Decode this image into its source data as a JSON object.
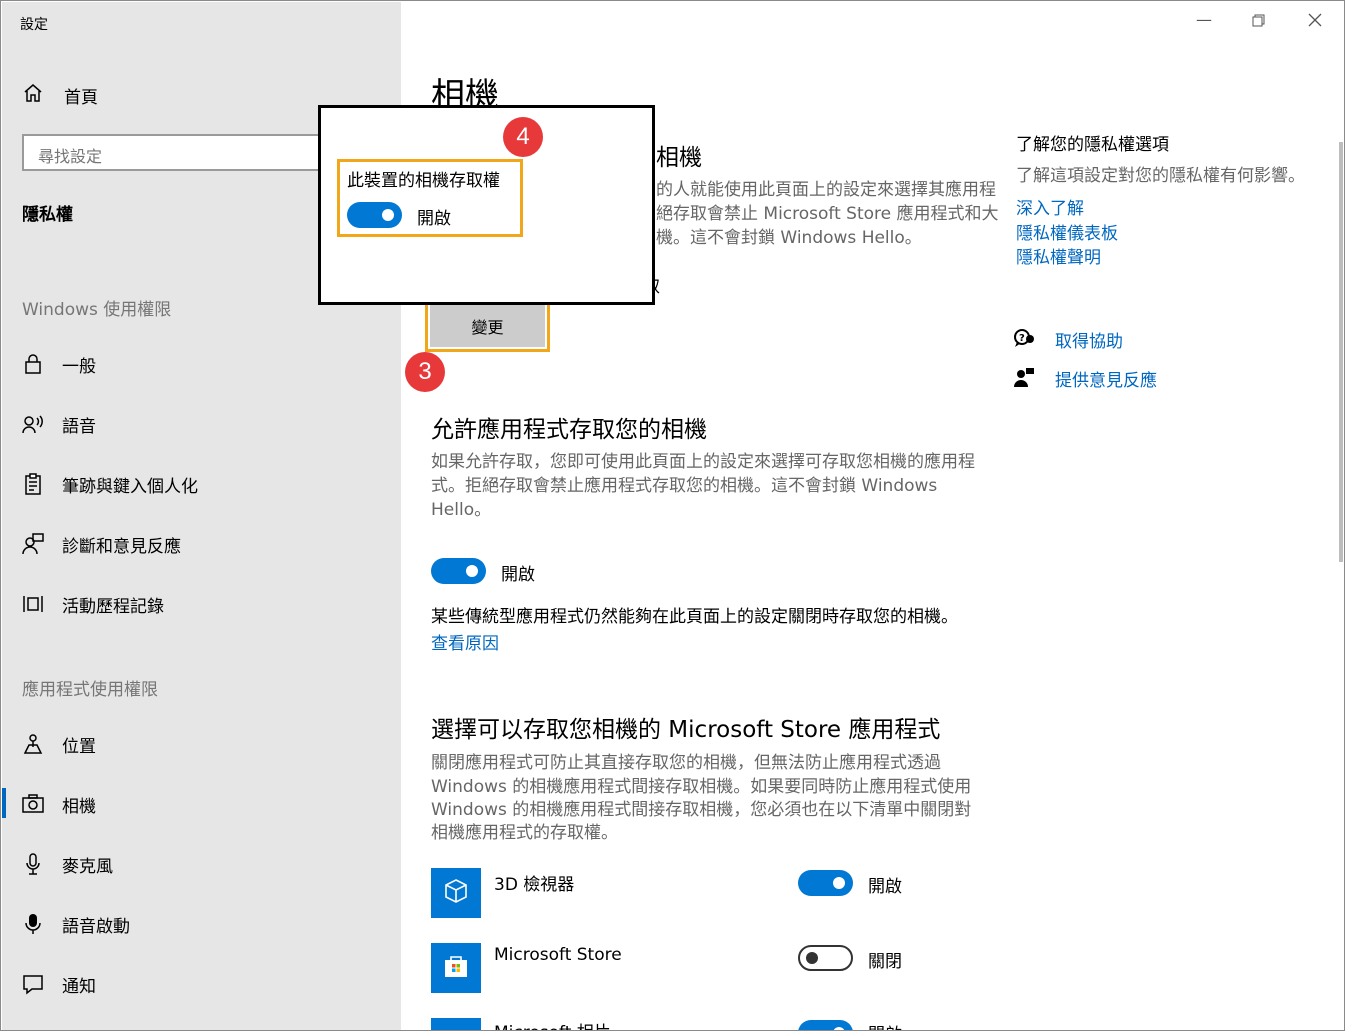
{
  "window": {
    "title": "設定"
  },
  "sidebar": {
    "home": "首頁",
    "search_placeholder": "尋找設定",
    "category": "隱私權",
    "section_windows": "Windows 使用權限",
    "windows_items": [
      {
        "label": "一般",
        "icon": "lock-icon"
      },
      {
        "label": "語音",
        "icon": "speech-icon"
      },
      {
        "label": "筆跡與鍵入個人化",
        "icon": "clipboard-icon"
      },
      {
        "label": "診斷和意見反應",
        "icon": "feedback-person-icon"
      },
      {
        "label": "活動歷程記錄",
        "icon": "timeline-icon"
      }
    ],
    "section_apps": "應用程式使用權限",
    "app_items": [
      {
        "label": "位置",
        "icon": "location-icon"
      },
      {
        "label": "相機",
        "icon": "camera-icon",
        "selected": true
      },
      {
        "label": "麥克風",
        "icon": "microphone-icon"
      },
      {
        "label": "語音啟動",
        "icon": "voice-activation-icon"
      },
      {
        "label": "通知",
        "icon": "notification-icon"
      }
    ]
  },
  "main": {
    "page_title": "相機",
    "section1": {
      "heading_partial": "相機",
      "desc_lines": [
        "的人就能使用此頁面上的設定來選擇其應用程",
        "絕存取會禁止 Microsoft Store 應用程式和大",
        "機。這不會封鎖 Windows Hello。"
      ],
      "partial_char": "取",
      "change_button": "變更"
    },
    "section2": {
      "heading": "允許應用程式存取您的相機",
      "desc_lines": [
        "如果允許存取，您即可使用此頁面上的設定來選擇可存取您相機的應用程",
        "式。拒絕存取會禁止應用程式存取您的相機。這不會封鎖 Windows",
        "Hello。"
      ],
      "toggle_label": "開啟",
      "toggle_on": true,
      "note": "某些傳統型應用程式仍然能夠在此頁面上的設定關閉時存取您的相機。",
      "note_link": "查看原因"
    },
    "section3": {
      "heading": "選擇可以存取您相機的 Microsoft Store 應用程式",
      "desc_lines": [
        "關閉應用程式可防止其直接存取您的相機，但無法防止應用程式透過",
        "Windows 的相機應用程式間接存取相機。如果要同時防止應用程式使用",
        "Windows 的相機應用程式間接存取相機，您必須也在以下清單中關閉對",
        "相機應用程式的存取權。"
      ],
      "apps": [
        {
          "name": "3D 檢視器",
          "state": "開啟",
          "on": true,
          "icon": "cube-icon"
        },
        {
          "name": "Microsoft Store",
          "state": "關閉",
          "on": false,
          "icon": "store-bag-icon"
        },
        {
          "name": "Microsoft 相片",
          "state": "開啟",
          "on": true,
          "icon": "photos-icon"
        }
      ]
    },
    "right": {
      "heading": "了解您的隱私權選項",
      "desc": "了解這項設定對您的隱私權有何影響。",
      "links": [
        "深入了解",
        "隱私權儀表板",
        "隱私權聲明"
      ],
      "help": "取得協助",
      "feedback": "提供意見反應"
    }
  },
  "popup": {
    "title": "此裝置的相機存取權",
    "toggle_label": "開啟",
    "toggle_on": true
  },
  "annotations": {
    "badge3": "3",
    "badge4": "4"
  },
  "colors": {
    "accent": "#0078d4",
    "highlight": "#f2a619",
    "badge": "#e8393a"
  }
}
